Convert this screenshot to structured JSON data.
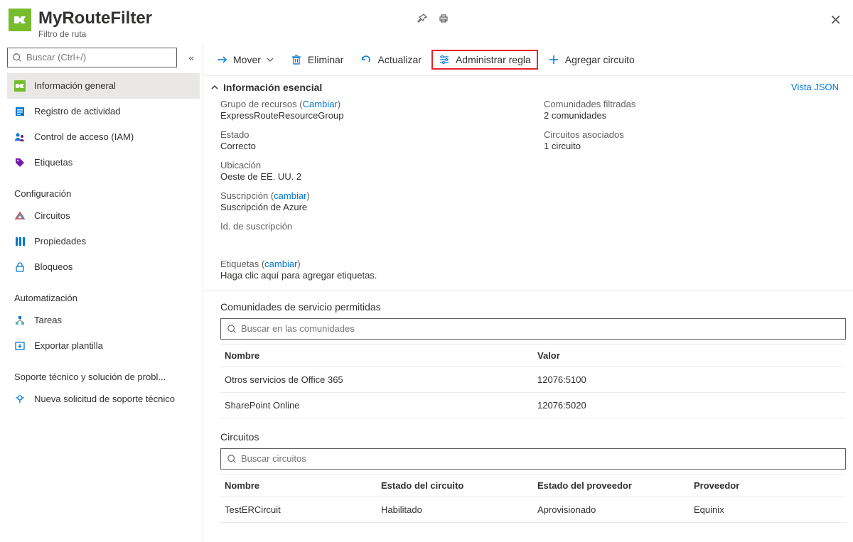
{
  "header": {
    "title": "MyRouteFilter",
    "subtitle": "Filtro de ruta"
  },
  "sidebar": {
    "search_placeholder": "Buscar (Ctrl+/)",
    "items": [
      {
        "label": "Información general"
      },
      {
        "label": "Registro de actividad"
      },
      {
        "label": "Control de acceso (IAM)"
      },
      {
        "label": "Etiquetas"
      }
    ],
    "sections": [
      {
        "title": "Configuración",
        "items": [
          {
            "label": "Circuitos"
          },
          {
            "label": "Propiedades"
          },
          {
            "label": "Bloqueos"
          }
        ]
      },
      {
        "title": "Automatización",
        "items": [
          {
            "label": "Tareas"
          },
          {
            "label": "Exportar plantilla"
          }
        ]
      },
      {
        "title": "Soporte técnico y solución de probl...",
        "items": [
          {
            "label": "Nueva solicitud de soporte técnico"
          }
        ]
      }
    ]
  },
  "toolbar": {
    "move": "Mover",
    "delete": "Eliminar",
    "refresh": "Actualizar",
    "manage_rule": "Administrar regla",
    "add_circuit": "Agregar circuito"
  },
  "essentials": {
    "title": "Información esencial",
    "json_view": "Vista JSON",
    "resource_group_label": "Grupo de recursos",
    "change": "Cambiar",
    "resource_group_value": "ExpressRouteResourceGroup",
    "state_label": "Estado",
    "state_value": "Correcto",
    "location_label": "Ubicación",
    "location_value": "Oeste de EE. UU. 2",
    "subscription_label": "Suscripción",
    "subscription_change": "cambiar",
    "subscription_value": "Suscripción de Azure",
    "subscription_id_label": "Id. de suscripción",
    "tags_label": "Etiquetas",
    "tags_change": "cambiar",
    "tags_value": "Haga clic aquí para agregar etiquetas.",
    "communities_label": "Comunidades filtradas",
    "communities_value": "2 comunidades",
    "circuits_label": "Circuitos asociados",
    "circuits_value": "1 circuito"
  },
  "communities": {
    "title": "Comunidades de servicio permitidas",
    "search_placeholder": "Buscar en las comunidades",
    "col_name": "Nombre",
    "col_value": "Valor",
    "rows": [
      {
        "name": "Otros servicios de Office 365",
        "value": "12076:5100"
      },
      {
        "name": "SharePoint Online",
        "value": "12076:5020"
      }
    ]
  },
  "circuits": {
    "title": "Circuitos",
    "search_placeholder": "Buscar circuitos",
    "col_name": "Nombre",
    "col_circuit_state": "Estado del circuito",
    "col_provider_state": "Estado del proveedor",
    "col_provider": "Proveedor",
    "rows": [
      {
        "name": "TestERCircuit",
        "circuit_state": "Habilitado",
        "provider_state": "Aprovisionado",
        "provider": "Equinix"
      }
    ]
  }
}
